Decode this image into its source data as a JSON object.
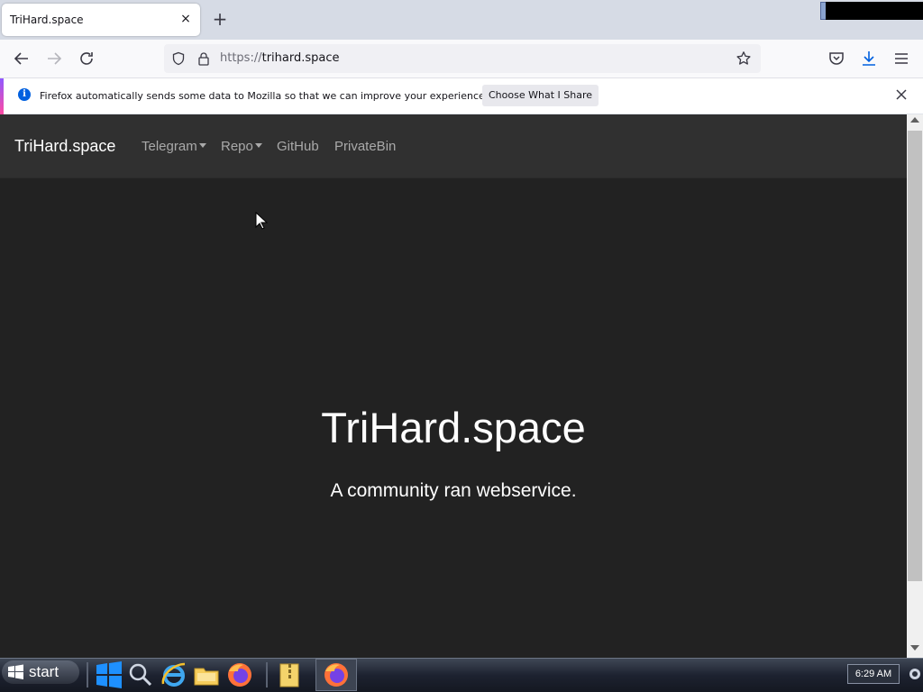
{
  "browser": {
    "tab": {
      "title": "TriHard.space",
      "close_glyph": "×"
    },
    "new_tab_glyph": "+",
    "url": {
      "protocol": "https://",
      "host": "trihard.space"
    },
    "icons": [
      "back-icon",
      "forward-icon",
      "reload-icon",
      "shield-icon",
      "lock-icon",
      "star-icon",
      "pocket-icon",
      "download-icon",
      "menu-icon"
    ]
  },
  "notification": {
    "text": "Firefox automatically sends some data to Mozilla so that we can improve your experience.",
    "button_label": "Choose What I Share",
    "info_glyph": "i",
    "accent_colors": [
      "#9059ff",
      "#ff4aa2"
    ]
  },
  "site": {
    "brand": "TriHard.space",
    "nav": [
      {
        "label": "Telegram",
        "dropdown": true
      },
      {
        "label": "Repo",
        "dropdown": true
      },
      {
        "label": "GitHub",
        "dropdown": false
      },
      {
        "label": "PrivateBin",
        "dropdown": false
      }
    ],
    "hero_title": "TriHard.space",
    "hero_subtitle": "A community ran webservice.",
    "colors": {
      "background": "#222222",
      "navbar": "#303030",
      "link": "#a9a9a9",
      "text": "#ffffff"
    }
  },
  "taskbar": {
    "start_label": "start",
    "icons": [
      "windows-logo-icon",
      "search-icon",
      "internet-explorer-icon",
      "file-explorer-icon",
      "firefox-icon",
      "archive-folder-icon",
      "firefox-icon"
    ],
    "clock": "6:29 AM"
  }
}
